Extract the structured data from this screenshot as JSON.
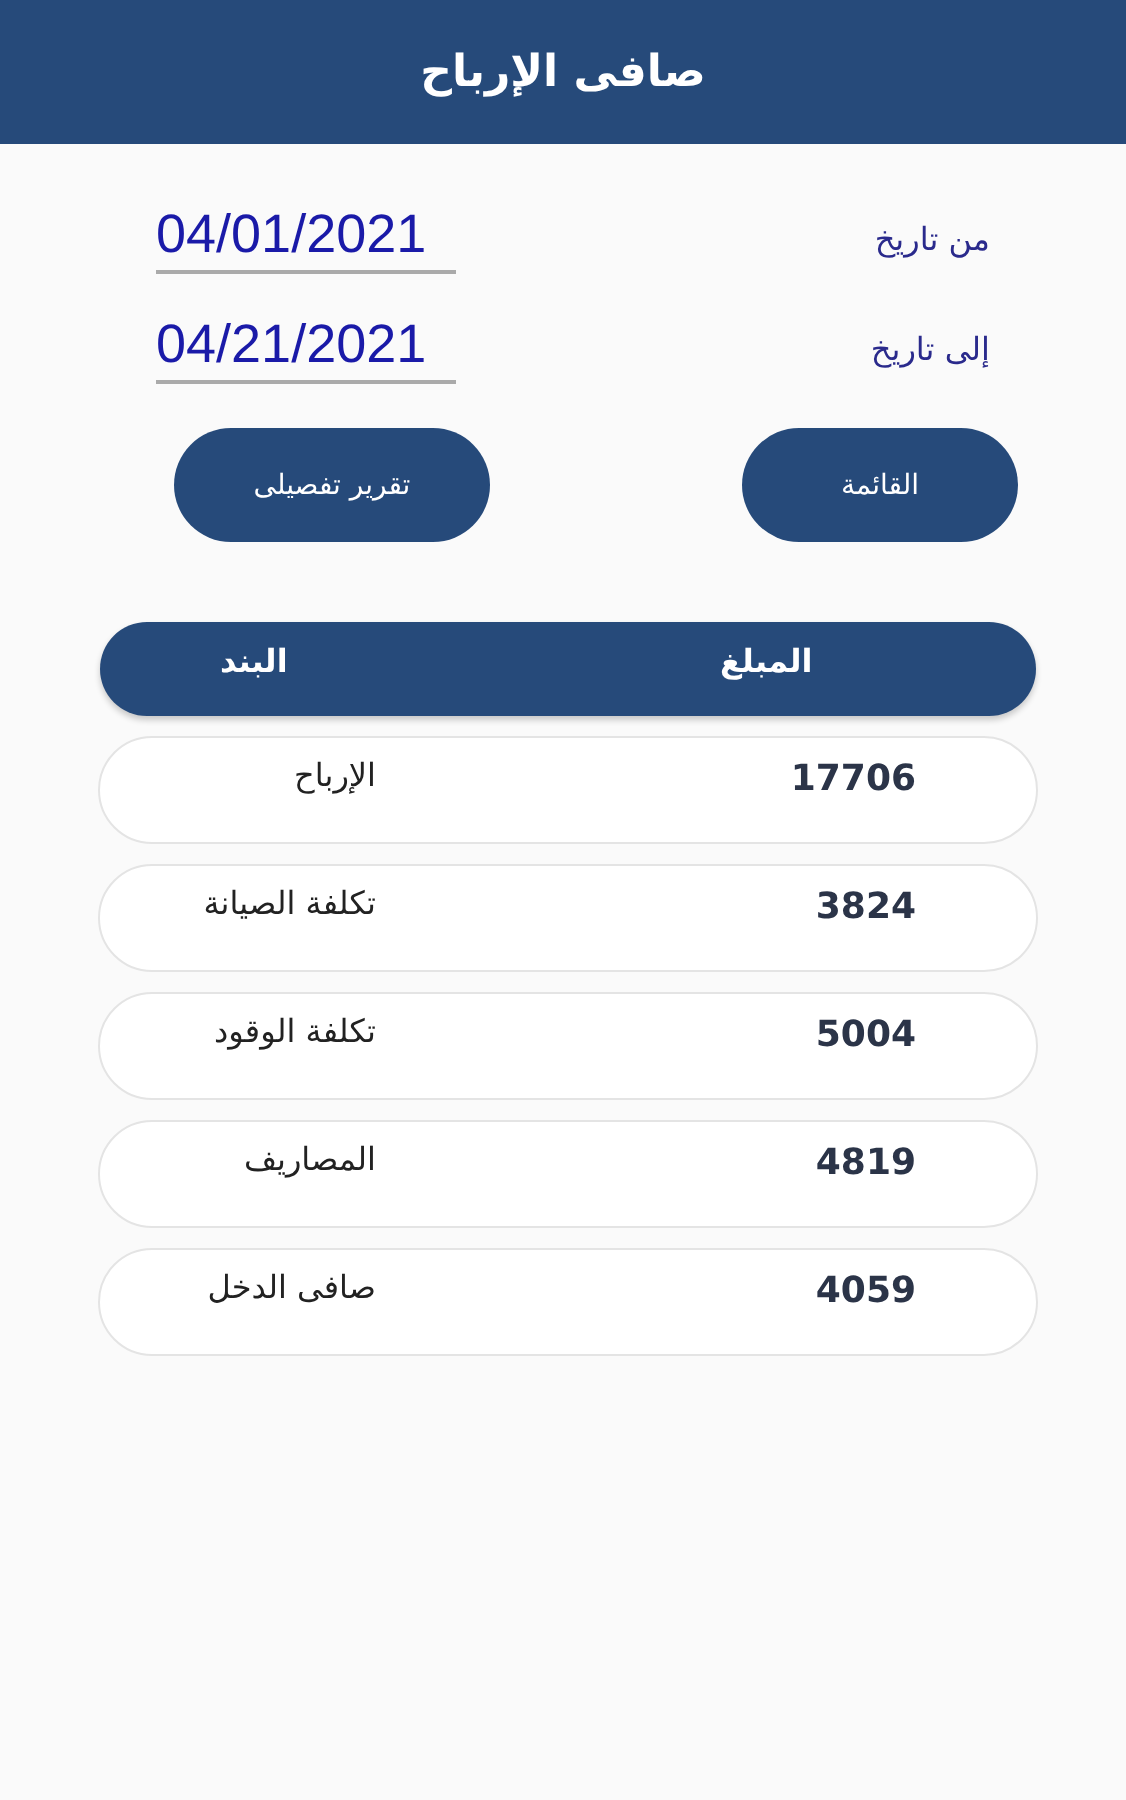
{
  "header": {
    "title": "صافى الإرباح"
  },
  "date_fields": [
    {
      "label": "من تاريخ",
      "value": "04/01/2021"
    },
    {
      "label": "إلى تاريخ",
      "value": "04/21/2021"
    }
  ],
  "buttons": [
    {
      "label": "القائمة"
    },
    {
      "label": "تقرير تفصيلى"
    }
  ],
  "table": {
    "columns": [
      "المبلغ",
      "البند"
    ],
    "rows": [
      {
        "amount": "17706",
        "item": "الإرباح"
      },
      {
        "amount": "3824",
        "item": "تكلفة الصيانة"
      },
      {
        "amount": "5004",
        "item": "تكلفة الوقود"
      },
      {
        "amount": "4819",
        "item": "المصاريف"
      },
      {
        "amount": "4059",
        "item": "صافى الدخل"
      }
    ]
  }
}
